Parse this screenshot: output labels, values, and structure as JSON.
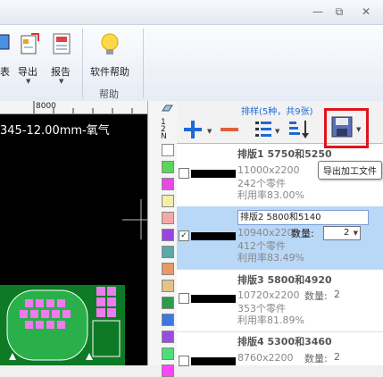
{
  "window": {
    "minimize_icon": "minimize-icon",
    "restore_icon": "restore-icon",
    "close_icon": "close-icon"
  },
  "ribbon": {
    "partial_label": "表",
    "export_label": "导出",
    "report_label": "报告",
    "help_label": "软件帮助",
    "help_group_label": "帮助"
  },
  "canvas": {
    "ruler_value": "8000",
    "title": "345-12.00mm-氧气"
  },
  "panel": {
    "header": "排样(5种，共9张)",
    "tooltip": "导出加工文件",
    "items": [
      {
        "title": "排版1 5750和5250",
        "size": "11000x2200",
        "parts": "242个零件",
        "util": "利用率83.00%",
        "qty_label": "",
        "qty": "",
        "checked": false,
        "selected": false
      },
      {
        "title": "排版2 5800和5140",
        "size": "10940x2200",
        "parts": "412个零件",
        "util": "利用率83.49%",
        "qty_label": "数量:",
        "qty": "2",
        "checked": true,
        "selected": true
      },
      {
        "title": "排版3 5800和4920",
        "size": "10720x2200",
        "parts": "353个零件",
        "util": "利用率81.89%",
        "qty_label": "数量:",
        "qty": "2",
        "checked": false,
        "selected": false
      },
      {
        "title": "排版4 5300和3460",
        "size": "8760x2200",
        "parts": "",
        "util": "",
        "qty_label": "数量:",
        "qty": "2",
        "checked": false,
        "selected": false
      }
    ]
  },
  "colors": {
    "accent_blue": "#1f68d6",
    "minus_red": "#e06040",
    "highlight": "#b9d7f7",
    "save_outline": "#e0141b",
    "swatches": [
      "#ffffff",
      "#5ad65a",
      "#e54ae5",
      "#f2eeaa",
      "#f3a9a9",
      "#9a44e2",
      "#5aa8a8",
      "#e89966",
      "#e2c38a",
      "#2a9d4a",
      "#3c78e0",
      "#9a4be0",
      "#4fdd7a",
      "#ff44ff"
    ]
  }
}
